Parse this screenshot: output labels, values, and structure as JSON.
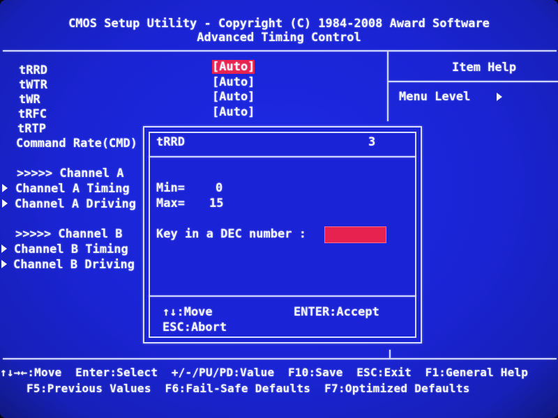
{
  "header": {
    "line1": "CMOS Setup Utility - Copyright (C) 1984-2008 Award Software",
    "line2": "Advanced Timing Control"
  },
  "settings": [
    {
      "label": "tRRD",
      "value": "[Auto]",
      "selected": true
    },
    {
      "label": "tWTR",
      "value": "[Auto]"
    },
    {
      "label": "tWR",
      "value": "[Auto]"
    },
    {
      "label": "tRFC",
      "value": "[Auto]"
    },
    {
      "label": "tRTP",
      "value": ""
    },
    {
      "label": "Command Rate(CMD)",
      "value": ""
    }
  ],
  "channel_a": {
    "header": ">>>>> Channel A",
    "items": [
      "Channel A Timing",
      "Channel A Driving"
    ]
  },
  "channel_b": {
    "header": ">>>>> Channel B",
    "items": [
      "Channel B Timing",
      "Channel B Driving"
    ]
  },
  "help": {
    "title": "Item Help",
    "menu_level": "Menu Level"
  },
  "dialog": {
    "title": "tRRD",
    "current": "3",
    "min_label": "Min=",
    "min_value": "0",
    "max_label": "Max=",
    "max_value": "15",
    "prompt": "Key in a DEC number :",
    "input_value": "",
    "move_hint": "↑↓:Move",
    "accept_hint": "ENTER:Accept",
    "abort_hint": "ESC:Abort"
  },
  "footer": {
    "line1": "↑↓→←:Move  Enter:Select  +/-/PU/PD:Value  F10:Save  ESC:Exit  F1:General Help",
    "line2": "F5:Previous Values  F6:Fail-Safe Defaults  F7:Optimized Defaults"
  },
  "colors": {
    "background": "#1a24d4",
    "highlight": "#e8224e",
    "text": "#f4f6ff"
  }
}
